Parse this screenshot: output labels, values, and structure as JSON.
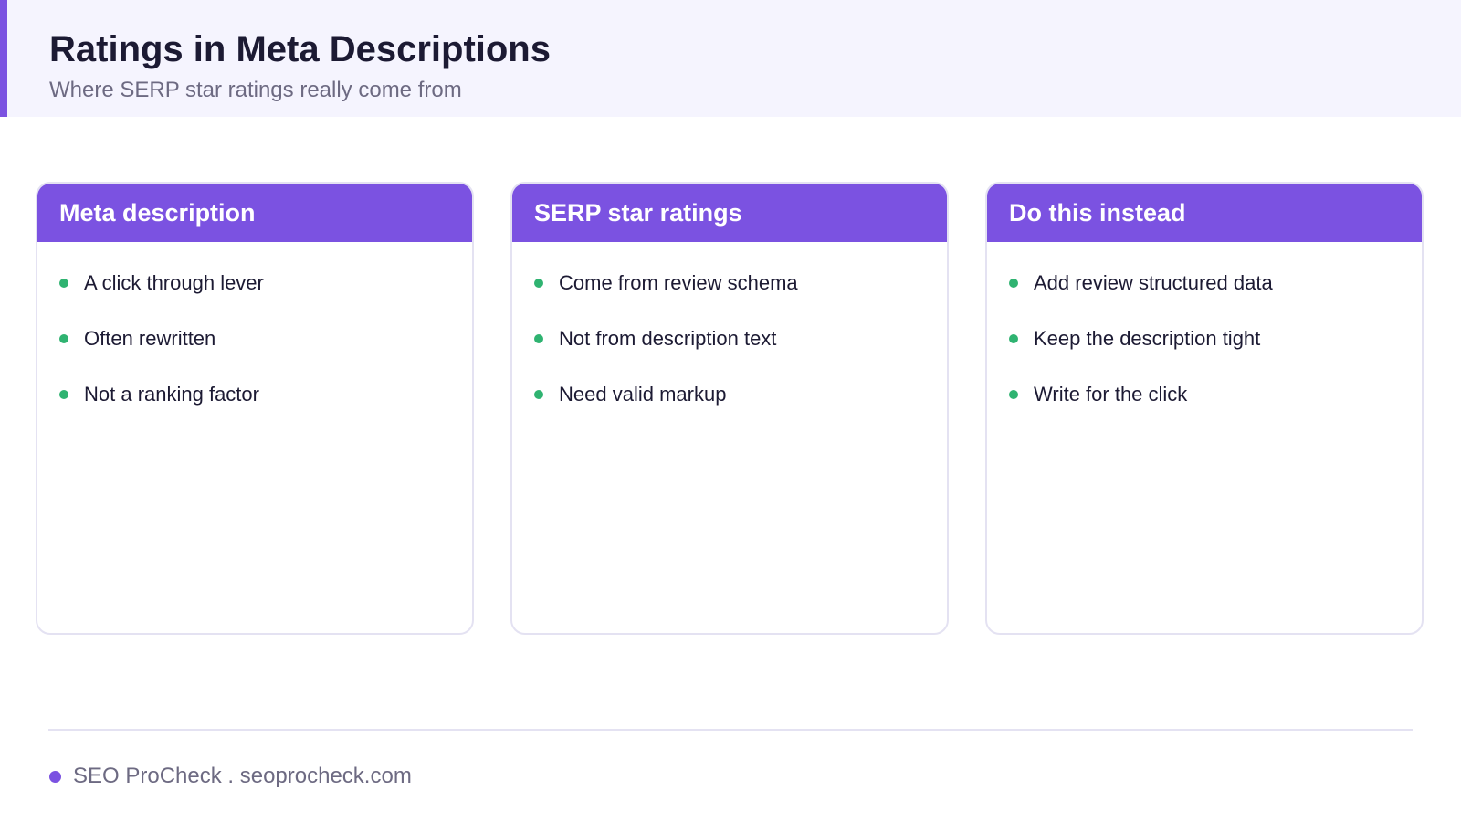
{
  "header": {
    "title": "Ratings in Meta Descriptions",
    "subtitle": "Where SERP star ratings really come from"
  },
  "cards": [
    {
      "title": "Meta description",
      "items": [
        "A click through lever",
        "Often rewritten",
        "Not a ranking factor"
      ]
    },
    {
      "title": "SERP star ratings",
      "items": [
        "Come from review schema",
        "Not from description text",
        "Need valid markup"
      ]
    },
    {
      "title": "Do this instead",
      "items": [
        "Add review structured data",
        "Keep the description tight",
        "Write for the click"
      ]
    }
  ],
  "footer": {
    "text": "SEO ProCheck . seoprocheck.com"
  },
  "colors": {
    "accent": "#7b52e1",
    "bullet": "#2fb371",
    "header_bg": "#f5f4fe",
    "heading_text": "#1c1a33",
    "muted_text": "#6d6a82",
    "card_border": "#e4e2f2"
  }
}
